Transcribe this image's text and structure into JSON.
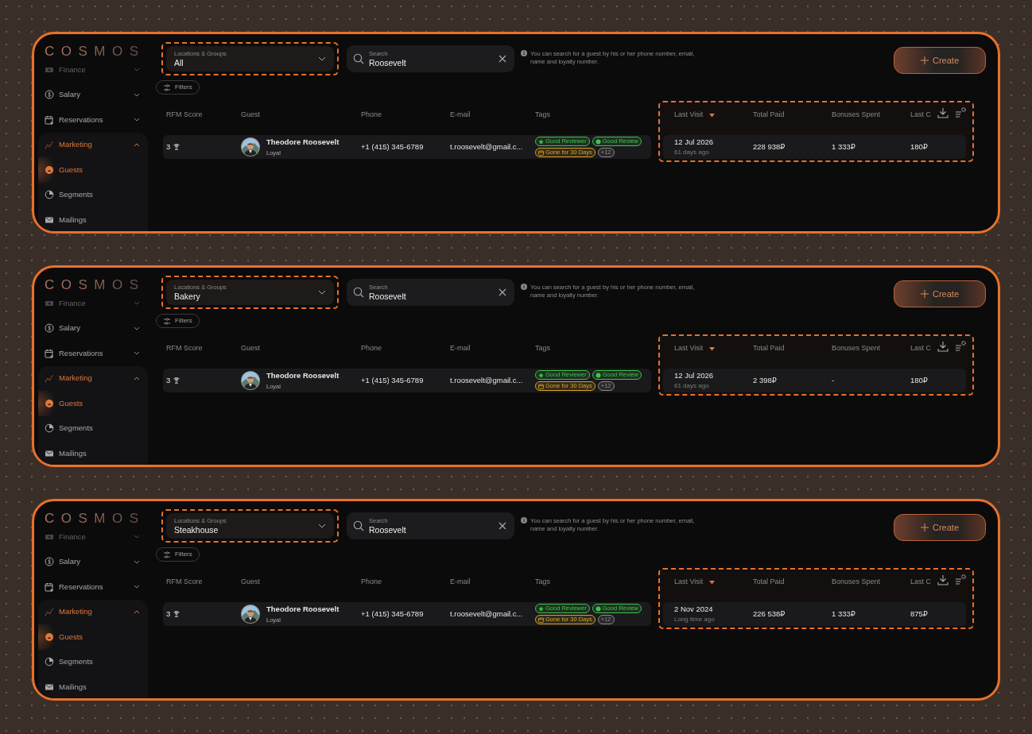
{
  "panels": [
    {
      "sidebar": {
        "logo": "COSMOS",
        "items": [
          {
            "label": "Finance",
            "dimmed": true,
            "expanded": false
          },
          {
            "label": "Salary",
            "dimmed": false,
            "expanded": false
          },
          {
            "label": "Reservations",
            "dimmed": false,
            "expanded": false
          },
          {
            "label": "Marketing",
            "dimmed": false,
            "expanded": true,
            "children": [
              {
                "label": "Guests",
                "selected": true
              },
              {
                "label": "Segments",
                "selected": false
              },
              {
                "label": "Mailings",
                "selected": false
              }
            ]
          }
        ]
      },
      "location": {
        "label": "Locations & Groups",
        "value": "All",
        "highlighted": true
      },
      "search": {
        "label": "Search",
        "value": "Roosevelt"
      },
      "hint": "You can search for a guest by his or her phone number, email, name and loyalty number.",
      "create_button": "Create",
      "filters_button": "Filters",
      "columns": [
        {
          "label": "RFM Score"
        },
        {
          "label": "Guest"
        },
        {
          "label": "Phone"
        },
        {
          "label": "E-mail"
        },
        {
          "label": "Tags"
        }
      ],
      "highlight_columns": [
        {
          "label": "Last Visit",
          "sorted": true
        },
        {
          "label": "Total Paid",
          "sorted": false
        },
        {
          "label": "Bonuses Spent",
          "sorted": false
        },
        {
          "label": "Last C",
          "sorted": false
        }
      ],
      "rows": [
        {
          "cells": [
            {
              "kind": "score",
              "text": "3"
            },
            {
              "kind": "guest",
              "name": "Theodore Roosevelt",
              "status": "Loyal"
            },
            {
              "kind": "text",
              "text": "+1 (415) 345-6789"
            },
            {
              "kind": "text",
              "text": "t.roosevelt@gmail.c..."
            },
            {
              "kind": "tags",
              "tags": [
                {
                  "kind": "star",
                  "label": "Good Reviewer",
                  "color": "#3fc24c"
                },
                {
                  "kind": "dot",
                  "label": "Good Review",
                  "color": "#3fc24c"
                },
                {
                  "kind": "calendar",
                  "label": "Gone for 30 Days",
                  "color": "#d9a21f"
                },
                {
                  "kind": "count",
                  "label": "+12",
                  "color": "#8a8a8a"
                }
              ]
            }
          ],
          "highlight_cells": [
            {
              "kind": "visit",
              "text": "12 Jul 2026",
              "sub": "61 days ago"
            },
            {
              "kind": "text",
              "text": "228 938₽"
            },
            {
              "kind": "text",
              "text": "1 333₽"
            },
            {
              "kind": "text",
              "text": "180₽"
            }
          ]
        }
      ]
    },
    {
      "sidebar": {
        "logo": "COSMOS",
        "items": [
          {
            "label": "Finance",
            "dimmed": true,
            "expanded": false
          },
          {
            "label": "Salary",
            "dimmed": false,
            "expanded": false
          },
          {
            "label": "Reservations",
            "dimmed": false,
            "expanded": false
          },
          {
            "label": "Marketing",
            "dimmed": false,
            "expanded": true,
            "children": [
              {
                "label": "Guests",
                "selected": true
              },
              {
                "label": "Segments",
                "selected": false
              },
              {
                "label": "Mailings",
                "selected": false
              }
            ]
          }
        ]
      },
      "location": {
        "label": "Locations & Groups",
        "value": "Bakery",
        "highlighted": true
      },
      "search": {
        "label": "Search",
        "value": "Roosevelt"
      },
      "hint": "You can search for a guest by his or her phone number, email, name and loyalty number.",
      "create_button": "Create",
      "filters_button": "Filters",
      "columns": [
        {
          "label": "RFM Score"
        },
        {
          "label": "Guest"
        },
        {
          "label": "Phone"
        },
        {
          "label": "E-mail"
        },
        {
          "label": "Tags"
        }
      ],
      "highlight_columns": [
        {
          "label": "Last Visit",
          "sorted": true
        },
        {
          "label": "Total Paid",
          "sorted": false
        },
        {
          "label": "Bonuses Spent",
          "sorted": false
        },
        {
          "label": "Last C",
          "sorted": false
        }
      ],
      "rows": [
        {
          "cells": [
            {
              "kind": "score",
              "text": "3"
            },
            {
              "kind": "guest",
              "name": "Theodore Roosevelt",
              "status": "Loyal"
            },
            {
              "kind": "text",
              "text": "+1 (415) 345-6789"
            },
            {
              "kind": "text",
              "text": "t.roosevelt@gmail.c..."
            },
            {
              "kind": "tags",
              "tags": [
                {
                  "kind": "star",
                  "label": "Good Reviewer",
                  "color": "#3fc24c"
                },
                {
                  "kind": "dot",
                  "label": "Good Review",
                  "color": "#3fc24c"
                },
                {
                  "kind": "calendar",
                  "label": "Gone for 30 Days",
                  "color": "#d9a21f"
                },
                {
                  "kind": "count",
                  "label": "+12",
                  "color": "#8a8a8a"
                }
              ]
            }
          ],
          "highlight_cells": [
            {
              "kind": "visit",
              "text": "12 Jul 2026",
              "sub": "61 days ago"
            },
            {
              "kind": "text",
              "text": "2 398₽"
            },
            {
              "kind": "text",
              "text": "-"
            },
            {
              "kind": "text",
              "text": "180₽"
            }
          ]
        }
      ]
    },
    {
      "sidebar": {
        "logo": "COSMOS",
        "items": [
          {
            "label": "Finance",
            "dimmed": true,
            "expanded": false
          },
          {
            "label": "Salary",
            "dimmed": false,
            "expanded": false
          },
          {
            "label": "Reservations",
            "dimmed": false,
            "expanded": false
          },
          {
            "label": "Marketing",
            "dimmed": false,
            "expanded": true,
            "children": [
              {
                "label": "Guests",
                "selected": true
              },
              {
                "label": "Segments",
                "selected": false
              },
              {
                "label": "Mailings",
                "selected": false
              }
            ]
          }
        ]
      },
      "location": {
        "label": "Locations & Groups",
        "value": "Steakhouse",
        "highlighted": true
      },
      "search": {
        "label": "Search",
        "value": "Roosevelt"
      },
      "hint": "You can search for a guest by his or her phone number, email, name and loyalty number.",
      "create_button": "Create",
      "filters_button": "Filters",
      "columns": [
        {
          "label": "RFM Score"
        },
        {
          "label": "Guest"
        },
        {
          "label": "Phone"
        },
        {
          "label": "E-mail"
        },
        {
          "label": "Tags"
        }
      ],
      "highlight_columns": [
        {
          "label": "Last Visit",
          "sorted": true
        },
        {
          "label": "Total Paid",
          "sorted": false
        },
        {
          "label": "Bonuses Spent",
          "sorted": false
        },
        {
          "label": "Last C",
          "sorted": false
        }
      ],
      "rows": [
        {
          "cells": [
            {
              "kind": "score",
              "text": "3"
            },
            {
              "kind": "guest",
              "name": "Theodore Roosevelt",
              "status": "Loyal"
            },
            {
              "kind": "text",
              "text": "+1 (415) 345-6789"
            },
            {
              "kind": "text",
              "text": "t.roosevelt@gmail.c..."
            },
            {
              "kind": "tags",
              "tags": [
                {
                  "kind": "star",
                  "label": "Good Reviewer",
                  "color": "#3fc24c"
                },
                {
                  "kind": "dot",
                  "label": "Good Review",
                  "color": "#3fc24c"
                },
                {
                  "kind": "calendar",
                  "label": "Gone for 30 Days",
                  "color": "#d9a21f"
                },
                {
                  "kind": "count",
                  "label": "+12",
                  "color": "#8a8a8a"
                }
              ]
            }
          ],
          "highlight_cells": [
            {
              "kind": "visit",
              "text": "2 Nov 2024",
              "sub": "Long time ago"
            },
            {
              "kind": "text",
              "text": "226 538₽"
            },
            {
              "kind": "text",
              "text": "1 333₽"
            },
            {
              "kind": "text",
              "text": "875₽"
            }
          ]
        }
      ]
    }
  ]
}
